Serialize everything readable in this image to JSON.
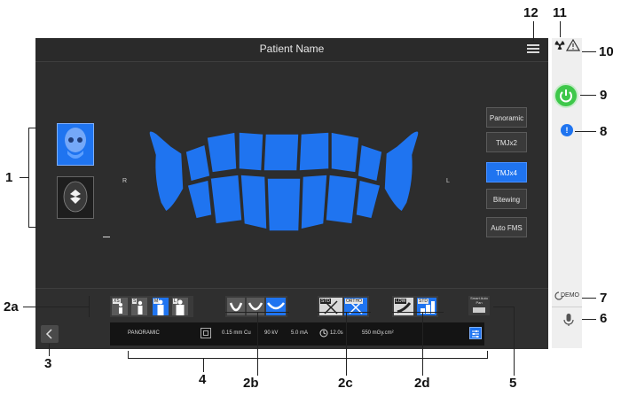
{
  "window": {
    "title": "Patient Name",
    "menu_icon": "hamburger-menu-icon"
  },
  "exam_modes": [
    {
      "label": "Panoramic",
      "selected": false
    },
    {
      "label": "TMJx2",
      "selected": false
    },
    {
      "label": "TMJx4",
      "selected": true
    },
    {
      "label": "Bitewing",
      "selected": false
    },
    {
      "label": "Auto FMS",
      "selected": false
    }
  ],
  "orientation": {
    "right": "R",
    "left": "L"
  },
  "patient_size": {
    "tags": [
      "XS",
      "S",
      "M",
      "L"
    ],
    "selected": "M"
  },
  "dose_tags": {
    "std": "STD",
    "ortho": "ORTHO",
    "low": "LOW",
    "std2": "STD"
  },
  "smart_auto": "Smart Auto Pan",
  "status": {
    "mode": "PANORAMIC",
    "filter": "0.15 mm Cu",
    "kv": "90 kV",
    "ma": "5.0 mA",
    "time": "12.0s",
    "dose": "550 mGy.cm²"
  },
  "side_panel": {
    "demo": "DEMO"
  },
  "callouts": {
    "c1": "1",
    "c2a": "2a",
    "c2b": "2b",
    "c2c": "2c",
    "c2d": "2d",
    "c3": "3",
    "c4": "4",
    "c5": "5",
    "c6": "6",
    "c7": "7",
    "c8": "8",
    "c9": "9",
    "c10": "10",
    "c11": "11",
    "c12": "12"
  },
  "colors": {
    "accent": "#1f74f0",
    "background": "#2d2d2d",
    "power": "#3ec84a"
  }
}
